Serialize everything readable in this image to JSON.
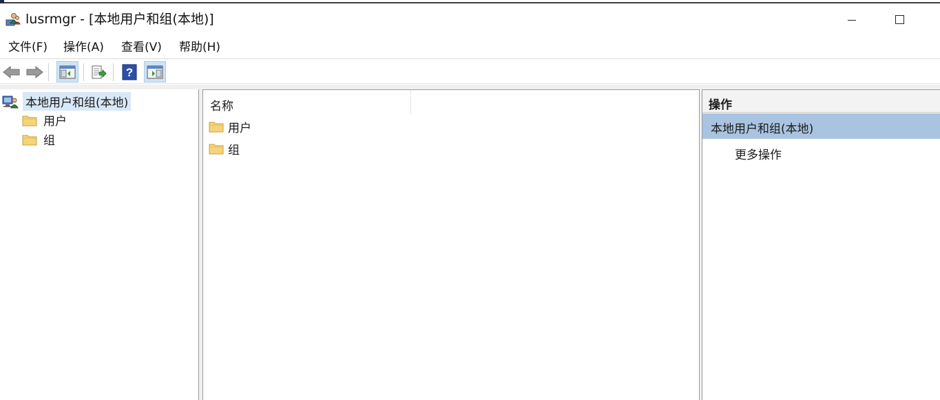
{
  "window": {
    "title": "lusrmgr - [本地用户和组(本地)]"
  },
  "menubar": {
    "items": [
      "文件(F)",
      "操作(A)",
      "查看(V)",
      "帮助(H)"
    ]
  },
  "toolbar": {
    "buttons": [
      "back-icon",
      "forward-icon",
      "show-hide-console-tree-icon",
      "export-list-icon",
      "help-icon",
      "show-hide-action-pane-icon"
    ]
  },
  "tree": {
    "root": "本地用户和组(本地)",
    "children": [
      "用户",
      "组"
    ]
  },
  "list": {
    "column_name": "名称",
    "items": [
      "用户",
      "组"
    ]
  },
  "actions": {
    "header": "操作",
    "section": "本地用户和组(本地)",
    "items": [
      "更多操作"
    ]
  },
  "colors": {
    "selection": "#d9e8f7",
    "action_section": "#a9c4e0",
    "folder": "#f5d37a"
  }
}
